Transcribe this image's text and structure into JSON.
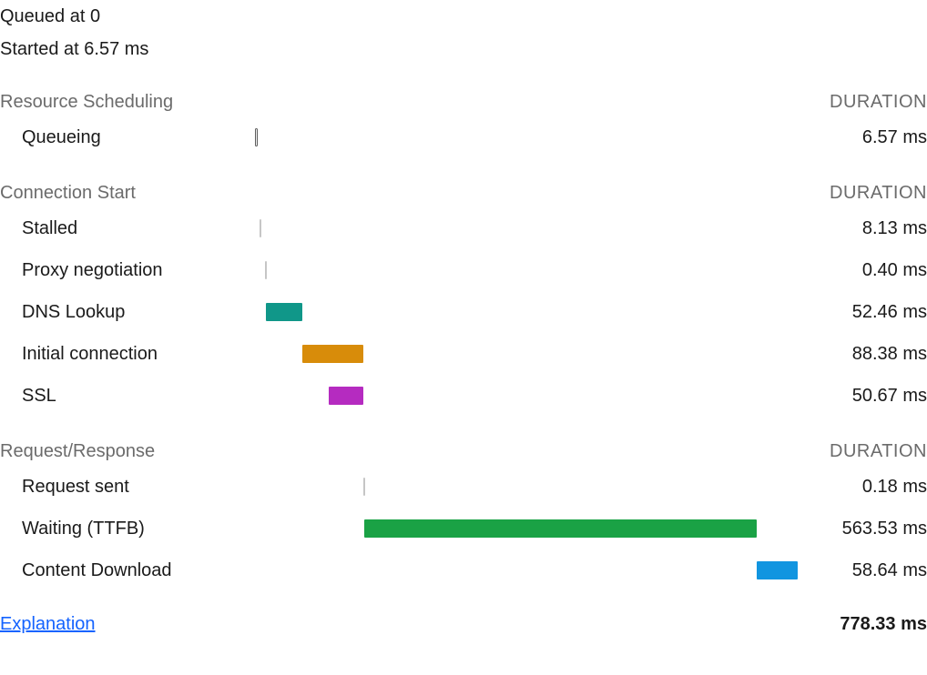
{
  "chart_data": {
    "type": "bar",
    "title": "",
    "xlabel": "",
    "ylabel": "DURATION",
    "series": [
      {
        "name": "Queueing",
        "start_ms": 0.0,
        "duration_ms": 6.57,
        "color": "#efefef",
        "style": "thin"
      },
      {
        "name": "Stalled",
        "start_ms": 6.57,
        "duration_ms": 8.13,
        "color": "#8a8a8a",
        "style": "hair"
      },
      {
        "name": "Proxy negotiation",
        "start_ms": 14.7,
        "duration_ms": 0.4,
        "color": "#c6c6c6",
        "style": "hair"
      },
      {
        "name": "DNS Lookup",
        "start_ms": 15.1,
        "duration_ms": 52.46,
        "color": "#109789",
        "style": "solid"
      },
      {
        "name": "Initial connection",
        "start_ms": 67.56,
        "duration_ms": 88.38,
        "color": "#d88c0a",
        "style": "solid"
      },
      {
        "name": "SSL",
        "start_ms": 105.27,
        "duration_ms": 50.67,
        "color": "#b52bc0",
        "style": "solid"
      },
      {
        "name": "Request sent",
        "start_ms": 155.94,
        "duration_ms": 0.18,
        "color": "#c6c6c6",
        "style": "hair"
      },
      {
        "name": "Waiting (TTFB)",
        "start_ms": 156.12,
        "duration_ms": 563.53,
        "color": "#1aa245",
        "style": "solid"
      },
      {
        "name": "Content Download",
        "start_ms": 719.65,
        "duration_ms": 58.64,
        "color": "#1195e0",
        "style": "solid"
      }
    ],
    "xlim": [
      0,
      778.33
    ],
    "total_ms": 778.33
  },
  "meta": {
    "queued_label": "Queued at 0",
    "started_label": "Started at 6.57 ms"
  },
  "sections": [
    {
      "title": "Resource Scheduling",
      "duration_label": "DURATION",
      "rows": [
        {
          "label": "Queueing",
          "value_text": "6.57 ms",
          "series_index": 0
        }
      ]
    },
    {
      "title": "Connection Start",
      "duration_label": "DURATION",
      "rows": [
        {
          "label": "Stalled",
          "value_text": "8.13 ms",
          "series_index": 1
        },
        {
          "label": "Proxy negotiation",
          "value_text": "0.40 ms",
          "series_index": 2
        },
        {
          "label": "DNS Lookup",
          "value_text": "52.46 ms",
          "series_index": 3
        },
        {
          "label": "Initial connection",
          "value_text": "88.38 ms",
          "series_index": 4
        },
        {
          "label": "SSL",
          "value_text": "50.67 ms",
          "series_index": 5
        }
      ]
    },
    {
      "title": "Request/Response",
      "duration_label": "DURATION",
      "rows": [
        {
          "label": "Request sent",
          "value_text": "0.18 ms",
          "series_index": 6
        },
        {
          "label": "Waiting (TTFB)",
          "value_text": "563.53 ms",
          "series_index": 7
        },
        {
          "label": "Content Download",
          "value_text": "58.64 ms",
          "series_index": 8
        }
      ]
    }
  ],
  "footer": {
    "explain_label": "Explanation",
    "total_text": "778.33 ms"
  }
}
